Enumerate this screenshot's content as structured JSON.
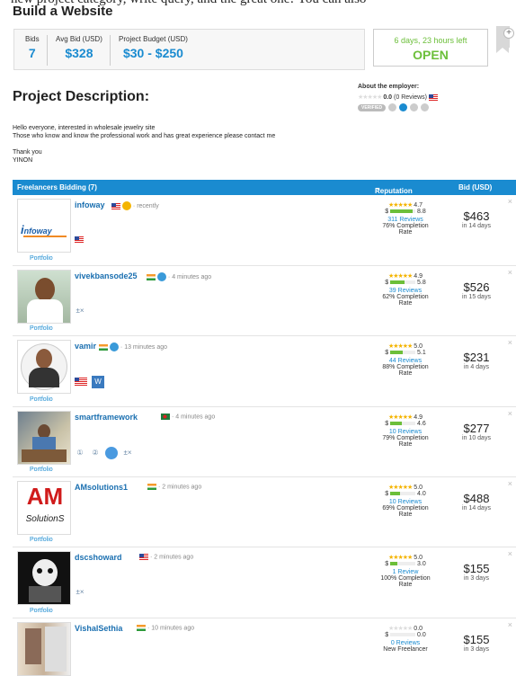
{
  "top_cut_text": "new project category, write query, and the great one! You can also",
  "title": "Build a Website",
  "stats": {
    "bids_label": "Bids",
    "bids_value": "7",
    "avg_label": "Avg Bid (USD)",
    "avg_value": "$328",
    "budget_label": "Project Budget (USD)",
    "budget_value": "$30 - $250"
  },
  "status": {
    "time_left": "6 days, 23 hours left",
    "state": "OPEN"
  },
  "section_title": "Project Description:",
  "employer": {
    "label": "About the employer:",
    "rating": "0.0",
    "reviews": "(0 Reviews)",
    "verified": "VERIFIED"
  },
  "description": [
    "Hello everyone, interested in wholesale jewelry site",
    "Those who know and know the professional work and has great experience please contact me",
    "",
    "Thank you",
    "YINON"
  ],
  "table": {
    "header": "Freelancers Bidding (7)",
    "rep_header": "Reputation",
    "bid_header": "Bid (USD)",
    "portfolio": "Portfolio"
  },
  "freelancers": [
    {
      "name": "infoway",
      "time": "recently",
      "stars": 4.7,
      "score": "4.7",
      "earn": "8.8",
      "earn_level": 0.88,
      "reviews": "311 Reviews",
      "completion": "76% Completion",
      "rate": "Rate",
      "bid": "$463",
      "days": "in 14 days"
    },
    {
      "name": "vivekbansode25",
      "time": "4 minutes ago",
      "stars": 4.9,
      "score": "4.9",
      "earn": "5.8",
      "earn_level": 0.58,
      "reviews": "39 Reviews",
      "completion": "62% Completion",
      "rate": "Rate",
      "bid": "$526",
      "days": "in 15 days"
    },
    {
      "name": "vamir",
      "time": "13 minutes ago",
      "stars": 5.0,
      "score": "5.0",
      "earn": "5.1",
      "earn_level": 0.51,
      "reviews": "44 Reviews",
      "completion": "88% Completion",
      "rate": "Rate",
      "bid": "$231",
      "days": "in 4 days"
    },
    {
      "name": "smartframework",
      "time": "4 minutes ago",
      "stars": 4.9,
      "score": "4.9",
      "earn": "4.6",
      "earn_level": 0.46,
      "reviews": "10 Reviews",
      "completion": "79% Completion",
      "rate": "Rate",
      "bid": "$277",
      "days": "in 10 days"
    },
    {
      "name": "AMsolutions1",
      "time": "2 minutes ago",
      "stars": 5.0,
      "score": "5.0",
      "earn": "4.0",
      "earn_level": 0.4,
      "reviews": "10 Reviews",
      "completion": "69% Completion",
      "rate": "Rate",
      "bid": "$488",
      "days": "in 14 days"
    },
    {
      "name": "dscshoward",
      "time": "2 minutes ago",
      "stars": 5.0,
      "score": "5.0",
      "earn": "3.0",
      "earn_level": 0.3,
      "reviews": "1 Review",
      "completion": "100% Completion",
      "rate": "Rate",
      "bid": "$155",
      "days": "in 3 days"
    },
    {
      "name": "VishalSethia",
      "time": "10 minutes ago",
      "stars": 0,
      "score": "0.0",
      "earn": "0.0",
      "earn_level": 0,
      "reviews": "0 Reviews",
      "completion": "New Freelancer",
      "rate": "",
      "bid": "$155",
      "days": "in 3 days"
    }
  ],
  "logo_text": {
    "infoway": "nfoway",
    "am_top": "AM",
    "am_bottom": "SolutionS"
  }
}
